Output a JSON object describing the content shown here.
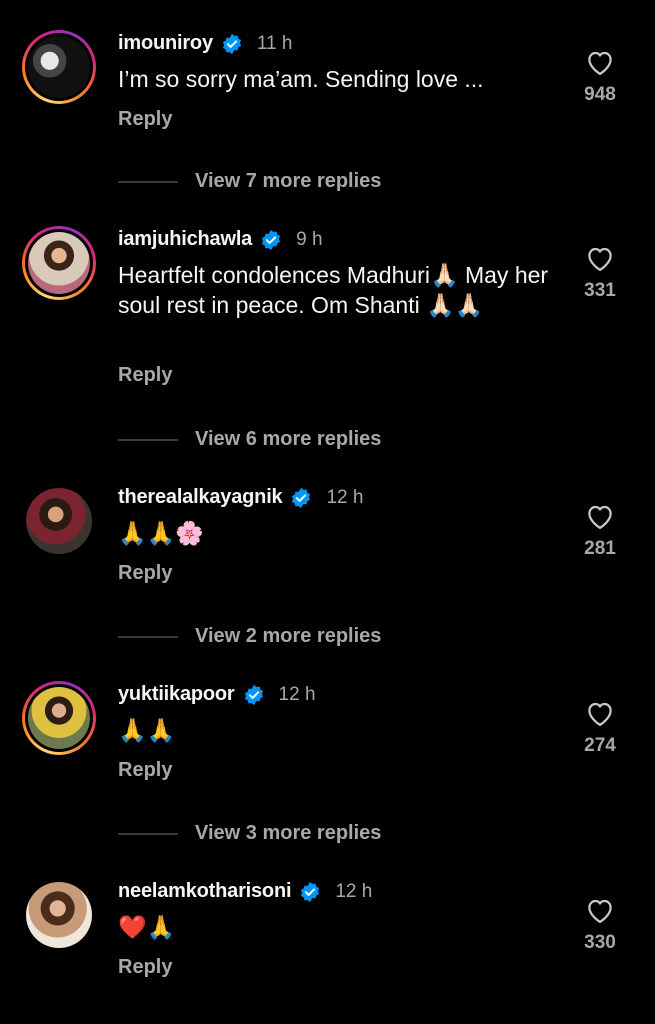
{
  "comments": [
    {
      "username": "imouniroy",
      "time": "11 h",
      "text": "I’m so sorry ma’am. Sending love ...",
      "reply_label": "Reply",
      "likes": "948",
      "view_replies": "View 7 more replies"
    },
    {
      "username": "iamjuhichawla",
      "time": "9 h",
      "text": "Heartfelt condolences Madhuri🙏🏻 May her soul rest in peace. Om Shanti 🙏🏻🙏🏻",
      "reply_label": "Reply",
      "likes": "331",
      "view_replies": "View 6 more replies"
    },
    {
      "username": "therealalkayagnik",
      "time": "12 h",
      "text": "🙏🙏🌸",
      "reply_label": "Reply",
      "likes": "281",
      "view_replies": "View 2 more replies"
    },
    {
      "username": "yuktiikapoor",
      "time": "12 h",
      "text": "🙏🙏",
      "reply_label": "Reply",
      "likes": "274",
      "view_replies": "View 3 more replies"
    },
    {
      "username": "neelamkotharisoni",
      "time": "12 h",
      "text": "❤️🙏",
      "reply_label": "Reply",
      "likes": "330"
    }
  ],
  "icons": {
    "verified": "verified-badge-icon",
    "like": "heart-outline-icon"
  },
  "colors": {
    "background": "#000000",
    "verified_blue": "#0095f6",
    "secondary_text": "#a8a8a8"
  }
}
